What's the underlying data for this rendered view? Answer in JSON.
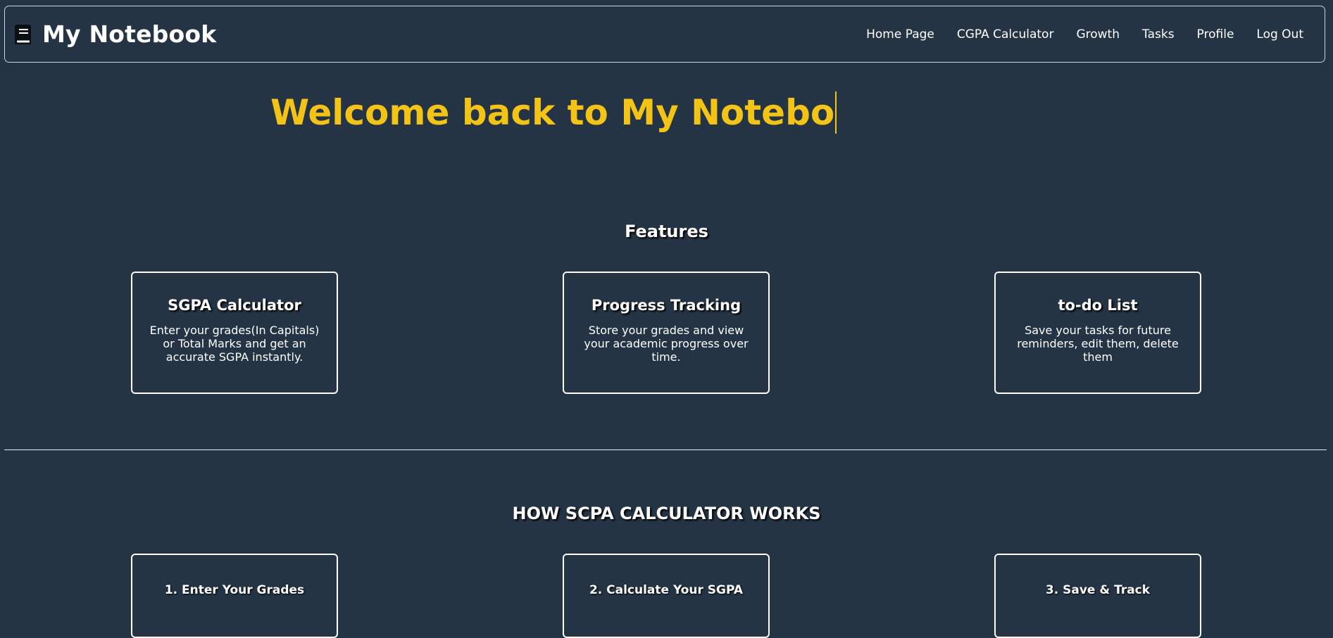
{
  "navbar": {
    "brand_icon": "book-icon",
    "brand_title": "My Notebook",
    "links": [
      "Home Page",
      "CGPA Calculator",
      "Growth",
      "Tasks",
      "Profile",
      "Log Out"
    ]
  },
  "hero": {
    "typed_text": "Welcome back to My Notebo",
    "color": "#f3c316"
  },
  "features": {
    "title": "Features",
    "cards": [
      {
        "title": "SGPA Calculator",
        "text": "Enter your grades(In Capitals) or Total Marks and get an accurate SGPA instantly."
      },
      {
        "title": "Progress Tracking",
        "text": "Store your grades and view your academic progress over time."
      },
      {
        "title": "to-do List",
        "text": "Save your tasks for future reminders, edit them, delete them"
      }
    ]
  },
  "how_it_works": {
    "title": "HOW SCPA CALCULATOR WORKS",
    "steps": [
      "1. Enter Your Grades",
      "2. Calculate Your SGPA",
      "3. Save & Track"
    ]
  },
  "colors": {
    "background": "#243444",
    "accent": "#f3c316",
    "text": "#ffffff"
  }
}
